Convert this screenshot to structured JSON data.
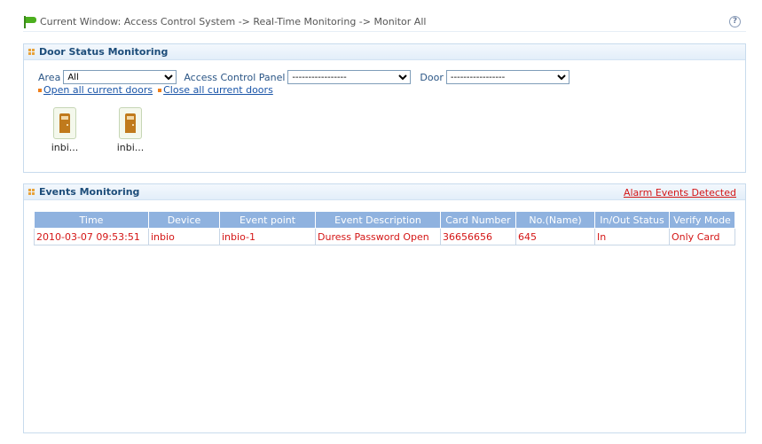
{
  "breadcrumb": {
    "text": "Current Window: Access Control System -> Real-Time Monitoring -> Monitor All",
    "help_glyph": "?"
  },
  "door_panel": {
    "title": "Door Status Monitoring",
    "area_label": "Area",
    "area_value": "All",
    "panel_label": "Access Control Panel",
    "panel_value": "-----------------",
    "door_label": "Door",
    "door_value": "-----------------",
    "open_all": "Open all current doors",
    "close_all": "Close all current doors",
    "doors": [
      "inbi...",
      "inbi..."
    ]
  },
  "events_panel": {
    "title": "Events Monitoring",
    "alarm_link": "Alarm Events Detected",
    "columns": [
      "Time",
      "Device",
      "Event point",
      "Event Description",
      "Card Number",
      "No.(Name)",
      "In/Out Status",
      "Verify Mode"
    ],
    "rows": [
      [
        "2010-03-07 09:53:51",
        "inbio",
        "inbio-1",
        "Duress Password Open",
        "36656656",
        "645",
        "In",
        "Only Card"
      ]
    ]
  },
  "colors": {
    "header_text": "#1d4d7a",
    "link": "#1a55a8",
    "alarm_red": "#d41616",
    "table_header_bg": "#8fb2df"
  },
  "icons": {
    "breadcrumb": "flag-icon",
    "help": "help-icon",
    "panel_header": "grid-dots-icon",
    "door": "door-icon"
  }
}
